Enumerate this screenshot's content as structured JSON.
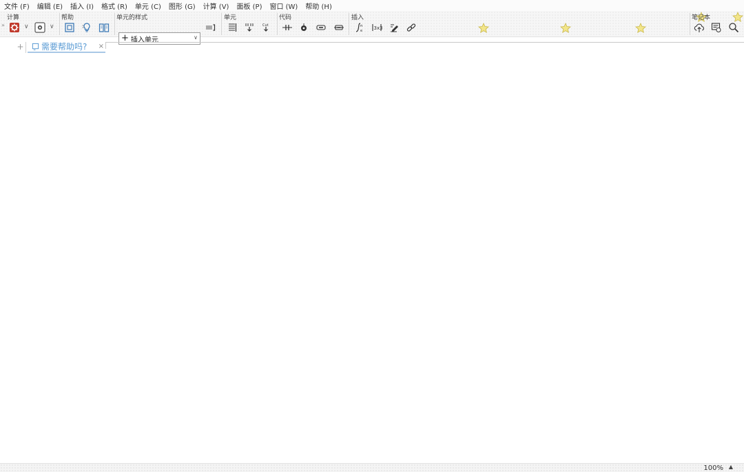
{
  "menu": [
    "文件 (F)",
    "编辑 (E)",
    "插入 (I)",
    "格式 (R)",
    "单元 (C)",
    "图形 (G)",
    "计算 (V)",
    "面板 (P)",
    "窗口 (W)",
    "帮助 (H)"
  ],
  "toolbar": {
    "groups": {
      "calc": "计算",
      "help": "帮助",
      "cell_style": "单元的样式",
      "cell": "单元",
      "code": "代码",
      "insert": "插入",
      "notebook": "笔记本"
    },
    "cell_style_select": {
      "value": "插入单元"
    },
    "colors": {
      "run_red": "#c0392b",
      "accent_blue": "#5a9bd4"
    }
  },
  "tabs": [
    {
      "label": "需要帮助吗?"
    }
  ],
  "status": {
    "zoom": "100%"
  }
}
